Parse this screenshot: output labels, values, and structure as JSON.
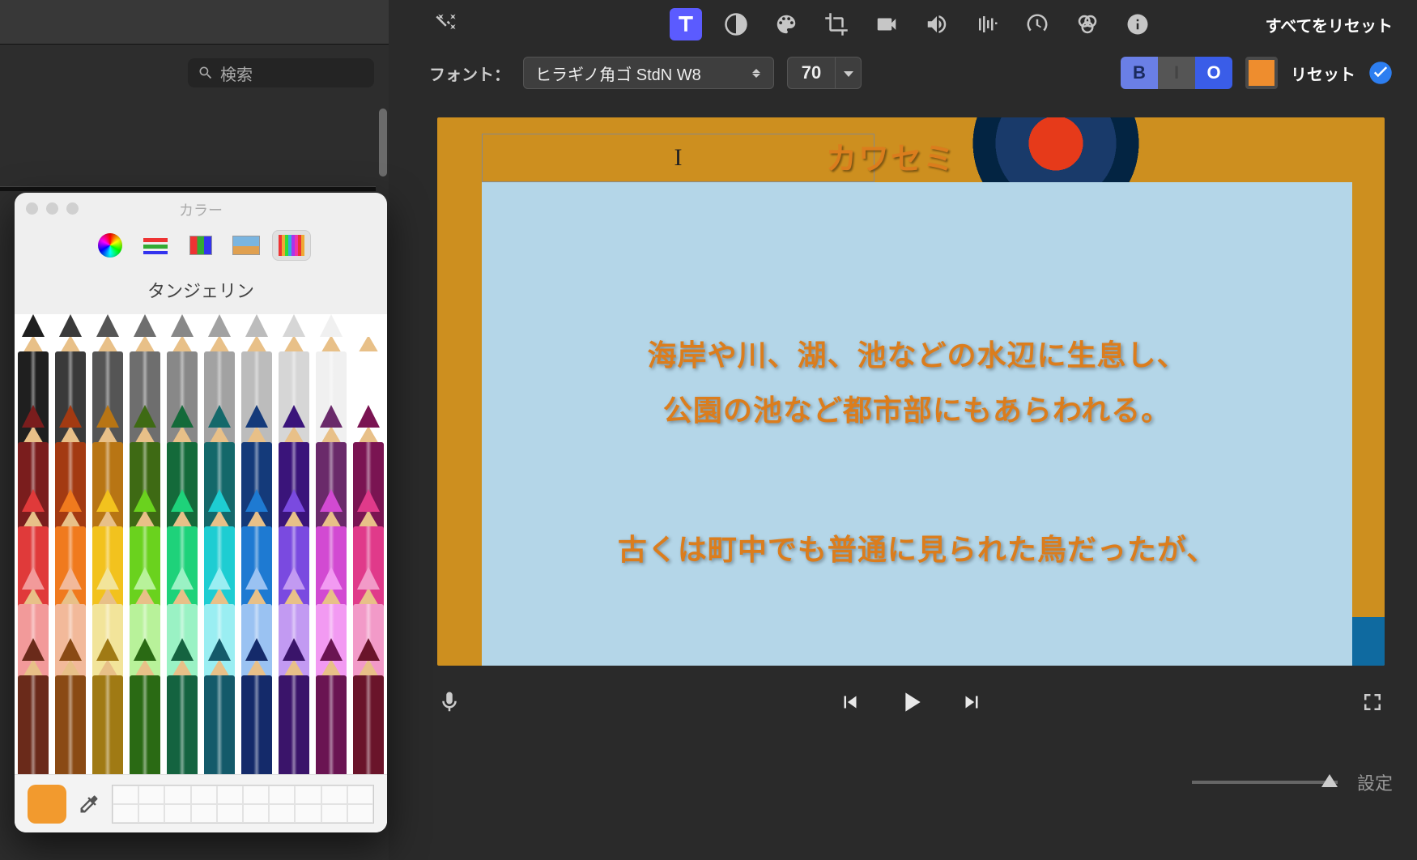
{
  "toolbar": {
    "reset_all": "すべてをリセット"
  },
  "font_bar": {
    "label": "フォント：",
    "font_name": "ヒラギノ角ゴ StdN W8",
    "size": "70",
    "style_b": "B",
    "style_i": "I",
    "style_o": "O",
    "reset": "リセット",
    "swatch_color": "#ee8d2e"
  },
  "preview": {
    "title": "カワセミ",
    "line1": "海岸や川、湖、池などの水辺に生息し、",
    "line2": "公園の池など都市部にもあらわれる。",
    "line3": "古くは町中でも普通に見られた鳥だったが、"
  },
  "search": {
    "placeholder": "検索"
  },
  "color_panel": {
    "title": "カラー",
    "color_name": "タンジェリン",
    "current_hex": "#f29a2e",
    "rows": [
      [
        "#1f1f1f",
        "#3a3a3a",
        "#555",
        "#6e6e6e",
        "#888",
        "#a2a2a2",
        "#bcbcbc",
        "#d6d6d6",
        "#f0f0f0",
        "#ffffff"
      ],
      [
        "#7a1d1d",
        "#a33a12",
        "#b87514",
        "#3e6a14",
        "#146a3a",
        "#14686a",
        "#143a7a",
        "#3a147a",
        "#6a2a6a",
        "#7a1452"
      ],
      [
        "#e03a3a",
        "#f07a1e",
        "#f2c21e",
        "#6ad21e",
        "#1ed27a",
        "#1ecdd2",
        "#1e7ad2",
        "#7a4ae0",
        "#d24ad2",
        "#e03a8a"
      ],
      [
        "#f29a9a",
        "#f2b99a",
        "#f2e49a",
        "#b8f29a",
        "#9af2c4",
        "#9aeef2",
        "#9ac2f2",
        "#c29af2",
        "#f29af2",
        "#f29ac8"
      ],
      [
        "#6a2a1a",
        "#8a4a14",
        "#a07a14",
        "#2a6a14",
        "#146340",
        "#145a6a",
        "#142a6a",
        "#3a146a",
        "#6a1452",
        "#6a142a"
      ]
    ]
  },
  "bottom": {
    "settings": "設定"
  }
}
